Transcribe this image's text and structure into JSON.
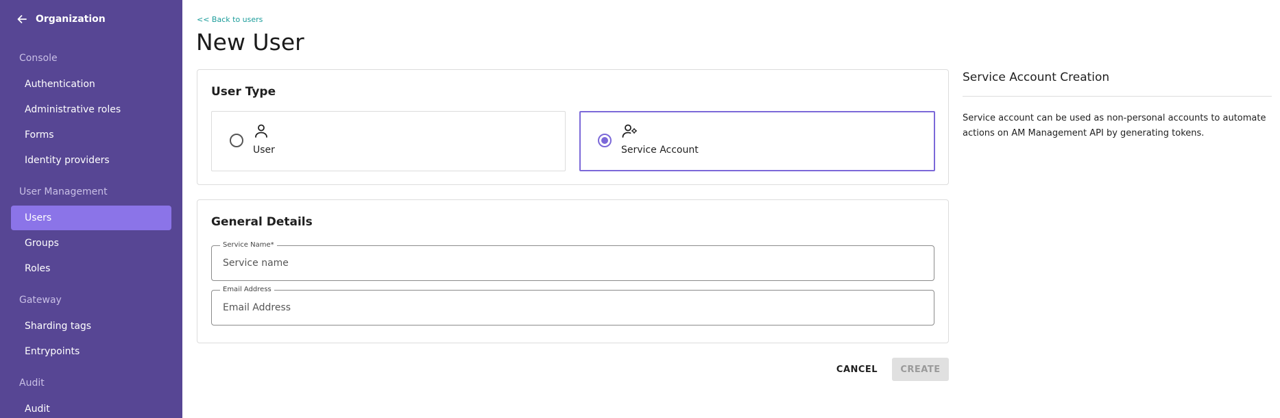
{
  "sidebar": {
    "back_label": "Organization",
    "sections": [
      {
        "title": "Console",
        "items": [
          "Authentication",
          "Administrative roles",
          "Forms",
          "Identity providers"
        ]
      },
      {
        "title": "User Management",
        "items": [
          "Users",
          "Groups",
          "Roles"
        ]
      },
      {
        "title": "Gateway",
        "items": [
          "Sharding tags",
          "Entrypoints"
        ]
      },
      {
        "title": "Audit",
        "items": [
          "Audit"
        ]
      }
    ],
    "active_item": "Users"
  },
  "main": {
    "back_link": "<< Back to users",
    "title": "New User",
    "user_type": {
      "title": "User Type",
      "options": [
        {
          "label": "User",
          "selected": false,
          "icon": "person-icon"
        },
        {
          "label": "Service Account",
          "selected": true,
          "icon": "person-gear-icon"
        }
      ]
    },
    "general_details": {
      "title": "General Details",
      "service_name": {
        "label": "Service Name*",
        "placeholder": "Service name",
        "value": ""
      },
      "email": {
        "label": "Email Address",
        "placeholder": "Email Address",
        "value": ""
      }
    },
    "actions": {
      "cancel": "CANCEL",
      "create": "CREATE"
    }
  },
  "help": {
    "title": "Service Account Creation",
    "text": "Service account can be used as non-personal accounts to automate actions on AM Management API by generating tokens."
  },
  "colors": {
    "sidebar_bg": "#574694",
    "active_item": "#8b74e8",
    "accent": "#7b68d8",
    "link": "#1a9c9a"
  }
}
